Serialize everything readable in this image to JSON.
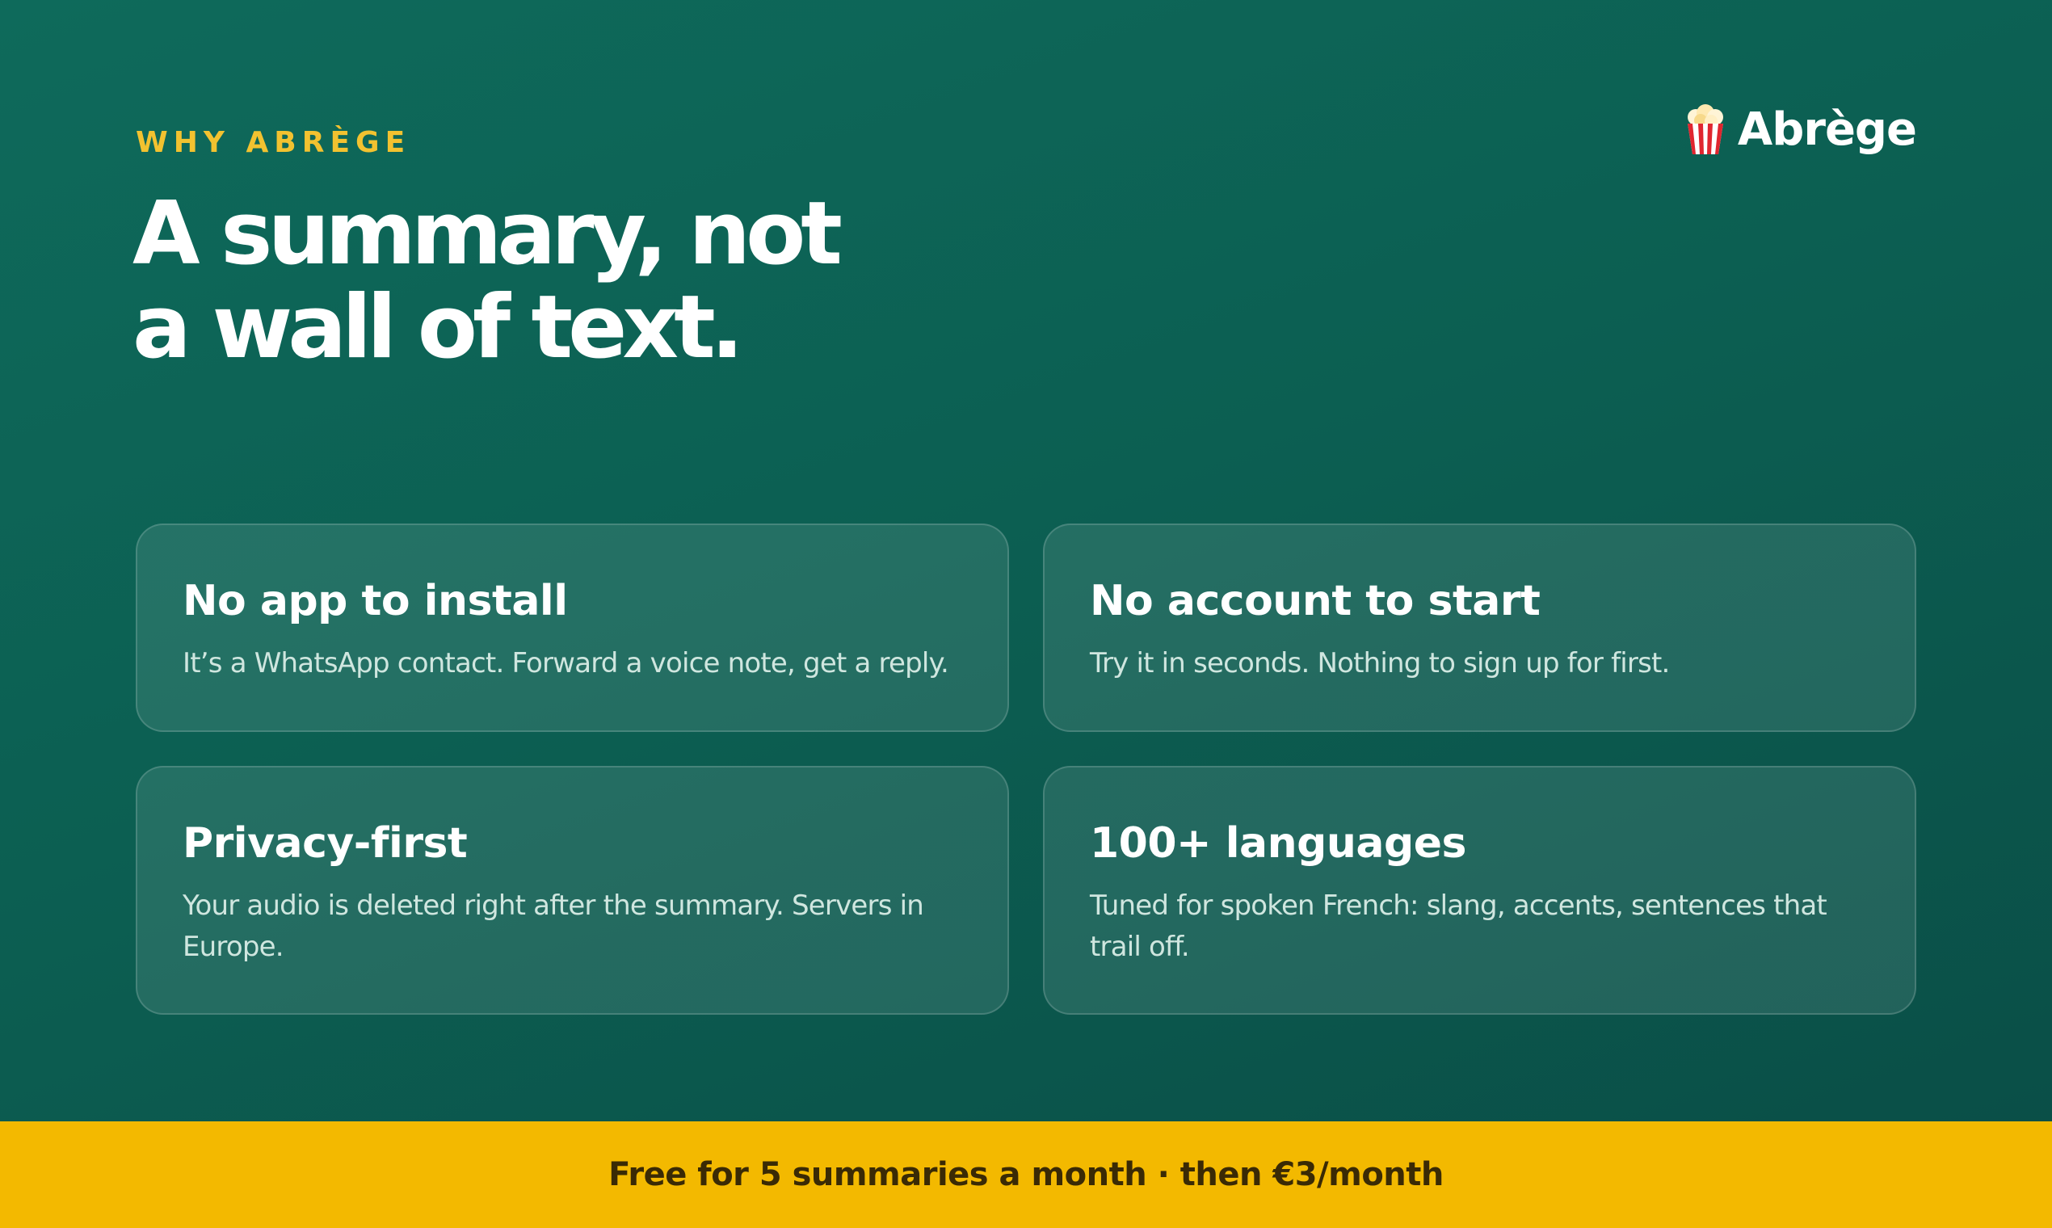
{
  "eyebrow": "WHY ABRÈGE",
  "brand": {
    "name": "Abrège",
    "icon": "popcorn-icon"
  },
  "headline": {
    "line1": "A summary, not",
    "line2": "a wall of text."
  },
  "features": [
    {
      "title": "No app to install",
      "text": "It’s a WhatsApp contact. Forward a voice note, get a reply."
    },
    {
      "title": "No account to start",
      "text": "Try it in seconds. Nothing to sign up for first."
    },
    {
      "title": "Privacy-first",
      "text": "Your audio is deleted right after the summary. Servers in Europe."
    },
    {
      "title": "100+ languages",
      "text": "Tuned for spoken French: slang, accents, sentences that trail off."
    }
  ],
  "footer": {
    "text": "Free for 5 summaries a month · then €3/month"
  },
  "colors": {
    "background": "#0c5f52",
    "accent_yellow": "#f2c230",
    "footer_band": "#f3b900"
  }
}
